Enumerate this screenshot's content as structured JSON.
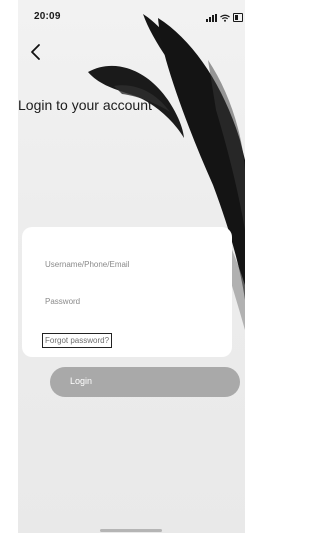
{
  "status_bar": {
    "time": "20:09"
  },
  "header": {
    "back_icon": "chevron-left-icon",
    "title": "Login to your account"
  },
  "form": {
    "username_placeholder": "Username/Phone/Email",
    "password_placeholder": "Password",
    "forgot_password_label": "Forgot password?",
    "login_button_label": "Login"
  },
  "colors": {
    "background": "#ececec",
    "card": "#ffffff",
    "login_button": "#a9a9a9",
    "leaf": "#141414"
  }
}
